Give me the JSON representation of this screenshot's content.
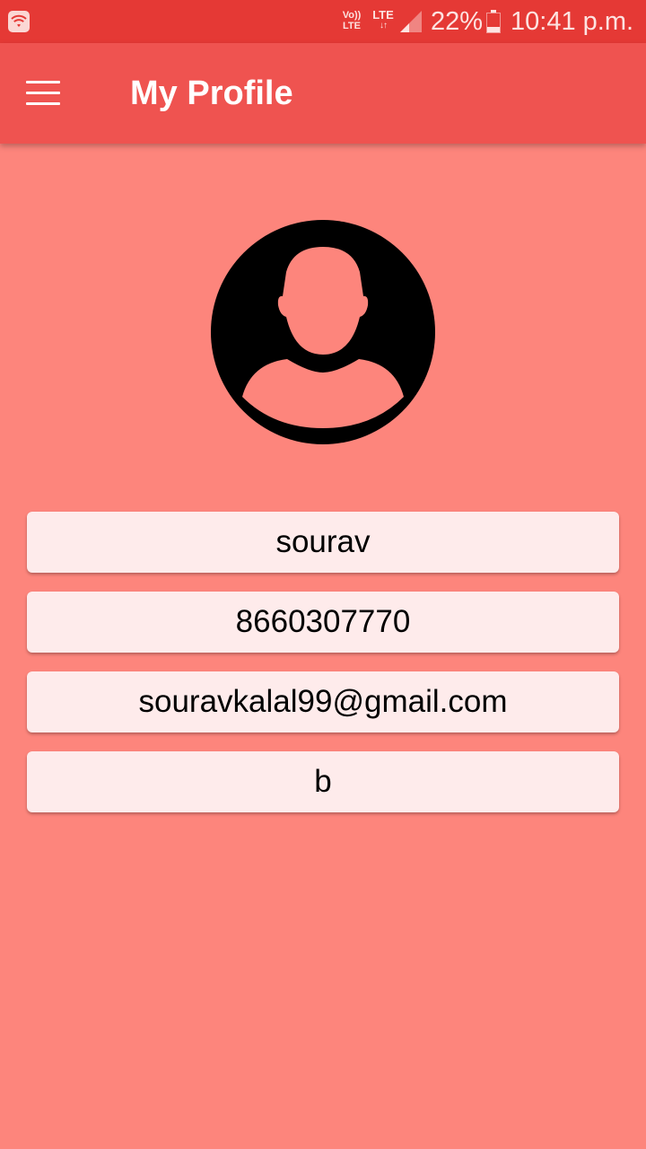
{
  "status_bar": {
    "volte_top": "Vo))",
    "volte_bottom": "LTE",
    "lte": "LTE",
    "lte_arrows": "↓↑",
    "battery": "22%",
    "time": "10:41 p.m."
  },
  "app_bar": {
    "title": "My Profile"
  },
  "profile": {
    "name": "sourav",
    "phone": "8660307770",
    "email": "souravkalal99@gmail.com",
    "extra": "b"
  },
  "colors": {
    "status_bar": "#e53935",
    "app_bar": "#ef5350",
    "background": "#fd857c",
    "field": "#feebeb"
  }
}
